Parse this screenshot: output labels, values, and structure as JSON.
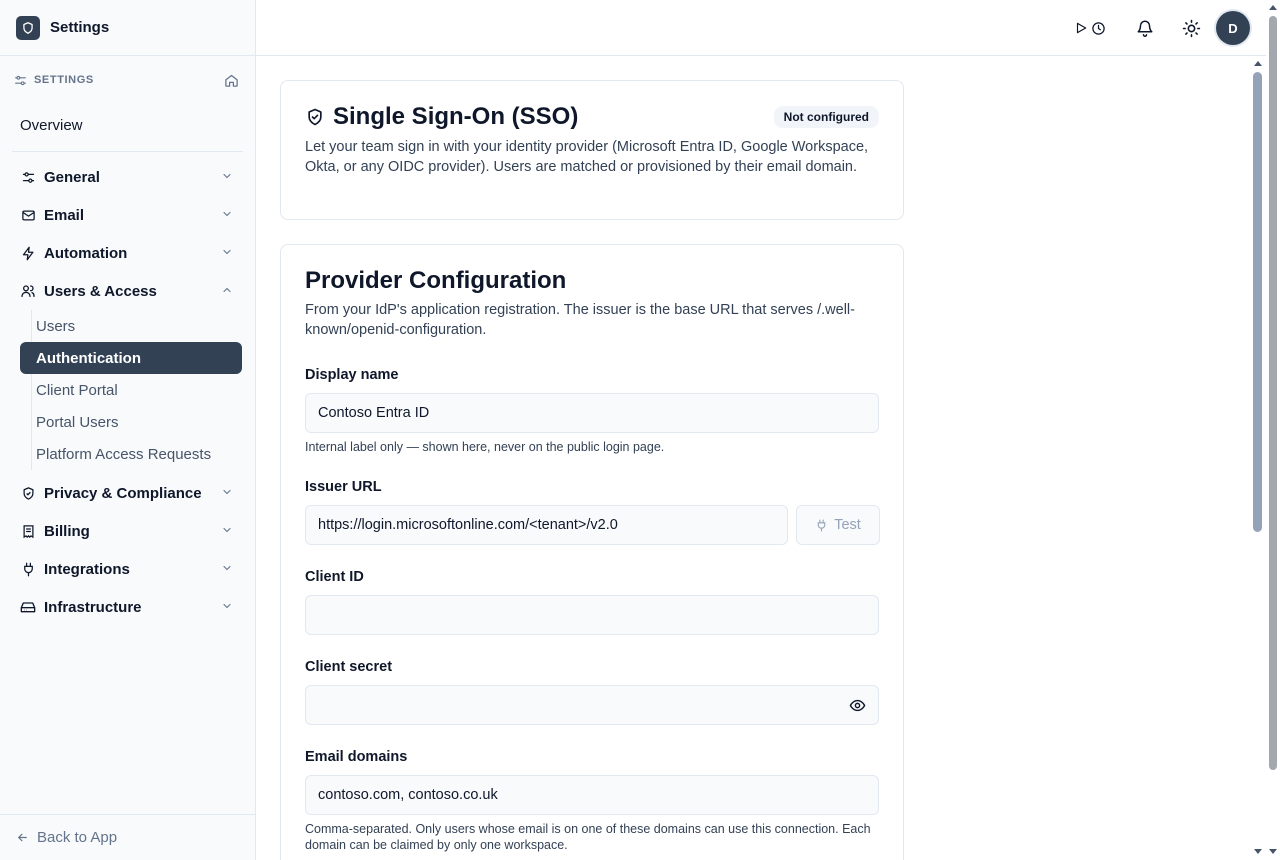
{
  "app": {
    "title": "Settings"
  },
  "sidebar": {
    "section_label": "SETTINGS",
    "overview": "Overview",
    "groups": [
      {
        "label": "General",
        "icon": "sliders-icon",
        "expanded": false
      },
      {
        "label": "Email",
        "icon": "mail-icon",
        "expanded": false
      },
      {
        "label": "Automation",
        "icon": "zap-icon",
        "expanded": false
      },
      {
        "label": "Users & Access",
        "icon": "users-icon",
        "expanded": true
      },
      {
        "label": "Privacy & Compliance",
        "icon": "shield-icon",
        "expanded": false
      },
      {
        "label": "Billing",
        "icon": "receipt-icon",
        "expanded": false
      },
      {
        "label": "Integrations",
        "icon": "plug-icon",
        "expanded": false
      },
      {
        "label": "Infrastructure",
        "icon": "hard-drive-icon",
        "expanded": false
      }
    ],
    "sub_items": [
      {
        "label": "Users",
        "active": false
      },
      {
        "label": "Authentication",
        "active": true
      },
      {
        "label": "Client Portal",
        "active": false
      },
      {
        "label": "Portal Users",
        "active": false
      },
      {
        "label": "Platform Access Requests",
        "active": false
      }
    ],
    "back_label": "Back to App"
  },
  "topbar": {
    "avatar_initial": "D"
  },
  "sso_card": {
    "title": "Single Sign-On (SSO)",
    "status": "Not configured",
    "description": "Let your team sign in with your identity provider (Microsoft Entra ID, Google Workspace, Okta, or any OIDC provider). Users are matched or provisioned by their email domain."
  },
  "provider": {
    "title": "Provider Configuration",
    "description": "From your IdP's application registration. The issuer is the base URL that serves /.well-known/openid-configuration.",
    "display_name": {
      "label": "Display name",
      "value": "Contoso Entra ID",
      "help": "Internal label only — shown here, never on the public login page."
    },
    "issuer_url": {
      "label": "Issuer URL",
      "value": "https://login.microsoftonline.com/<tenant>/v2.0",
      "test_label": "Test"
    },
    "client_id": {
      "label": "Client ID",
      "value": ""
    },
    "client_secret": {
      "label": "Client secret",
      "value": ""
    },
    "email_domains": {
      "label": "Email domains",
      "value": "contoso.com, contoso.co.uk",
      "help": "Comma-separated. Only users whose email is on one of these domains can use this connection. Each domain can be claimed by only one workspace."
    }
  }
}
